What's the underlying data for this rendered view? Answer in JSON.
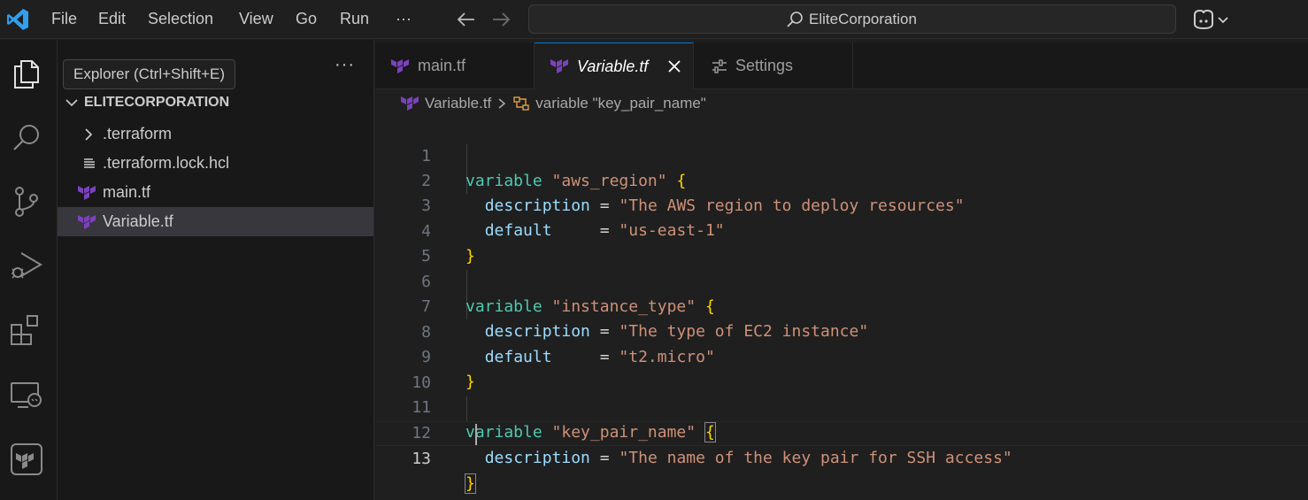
{
  "menu": {
    "file": "File",
    "edit": "Edit",
    "selection": "Selection",
    "view": "View",
    "go": "Go",
    "run": "Run",
    "more": "···"
  },
  "search": {
    "text": "EliteCorporation"
  },
  "tooltip": {
    "text": "Explorer (Ctrl+Shift+E)"
  },
  "explorer": {
    "more": "···",
    "folder": "ELITECORPORATION",
    "items": [
      {
        "label": ".terraform",
        "icon": "chevron-right-icon"
      },
      {
        "label": ".terraform.lock.hcl",
        "icon": "lines-file-icon"
      },
      {
        "label": "main.tf",
        "icon": "terraform-icon"
      },
      {
        "label": "Variable.tf",
        "icon": "terraform-icon"
      }
    ]
  },
  "tabs": [
    {
      "label": "main.tf"
    },
    {
      "label": "Variable.tf"
    },
    {
      "label": "Settings"
    }
  ],
  "breadcrumb": {
    "file": "Variable.tf",
    "symbol": "variable \"key_pair_name\""
  },
  "editor": {
    "active_line": 13,
    "line_numbers": [
      "1",
      "2",
      "3",
      "4",
      "5",
      "6",
      "7",
      "8",
      "9",
      "10",
      "11",
      "12",
      "13"
    ],
    "code": {
      "l1_kw": "variable",
      "l1_name": "\"aws_region\"",
      "l1_brace": "{",
      "l2_prop": "description",
      "l2_eq": "=",
      "l2_val": "\"The AWS region to deploy resources\"",
      "l3_prop": "default",
      "l3_eq": "=",
      "l3_val": "\"us-east-1\"",
      "l4_brace": "}",
      "l6_kw": "variable",
      "l6_name": "\"instance_type\"",
      "l6_brace": "{",
      "l7_prop": "description",
      "l7_eq": "=",
      "l7_val": "\"The type of EC2 instance\"",
      "l8_prop": "default",
      "l8_eq": "=",
      "l8_val": "\"t2.micro\"",
      "l9_brace": "}",
      "l11_kw": "variable",
      "l11_name": "\"key_pair_name\"",
      "l11_brace": "{",
      "l12_prop": "description",
      "l12_eq": "=",
      "l12_val": "\"The name of the key pair for SSH access\"",
      "l13_brace": "}"
    }
  },
  "colors": {
    "accent": "#0078d4",
    "terraform": "#7b42bc",
    "keyword": "#4ec9b0",
    "string": "#ce9178",
    "property": "#9cdcfe",
    "bracket": "#ffd700"
  }
}
